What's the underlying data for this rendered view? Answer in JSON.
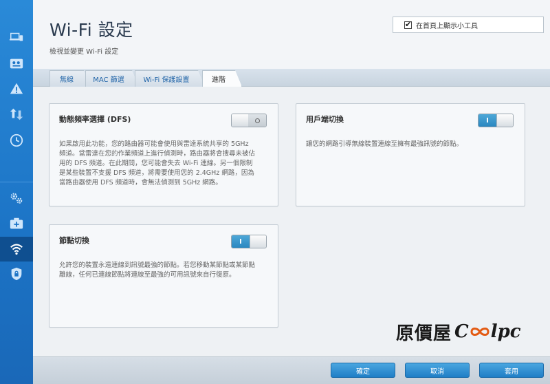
{
  "header": {
    "title": "Wi-Fi 設定",
    "subtitle": "檢視並變更 Wi-Fi 設定",
    "widget_label": "在首頁上顯示小工具"
  },
  "tabs": [
    {
      "label": "無線"
    },
    {
      "label": "MAC 篩選"
    },
    {
      "label": "Wi-Fi 保護設置"
    },
    {
      "label": "進階"
    }
  ],
  "cards": {
    "dfs": {
      "title": "動態頻率選擇 (DFS)",
      "desc_lines": [
        "如果啟用此功能，您的路由器可能會使用與雷達系統共享的 5GHz",
        "頻道。當雷達在您的作業頻道上進行偵測時，路由器將會搜尋未被佔",
        "用的 DFS 頻道。在此期間，您可能會失去 Wi-Fi 連線。另一個限制",
        "是某些裝置不支援 DFS 頻道，將需要使用您的 2.4GHz 網路，因為",
        "當路由器使用 DFS 頻道時，會無法偵測到 5GHz 網路。"
      ],
      "toggle_state": "off"
    },
    "client": {
      "title": "用戶端切換",
      "desc_lines": [
        "讓您的網路引導無線裝置連線至擁有最強訊號的節點。"
      ],
      "toggle_state": "on",
      "toggle_on_label": "I"
    },
    "node": {
      "title": "節點切換",
      "desc_lines": [
        "允許您的裝置永遠連線到訊號最強的節點。若您移動某節點或某節點",
        "離線，任何已連線節點將連線至最強的可用訊號來自行復原。"
      ],
      "toggle_state": "on",
      "toggle_on_label": "I"
    }
  },
  "footer": {
    "ok_label": "確定",
    "cancel_label": "取消",
    "apply_label": "套用"
  },
  "watermark": {
    "cn": "原價屋",
    "en_c": "C",
    "en_rest": "lpc"
  },
  "sidebar": {
    "icons": [
      "devices-icon",
      "parental-icon",
      "warning-icon",
      "update-icon",
      "clock-icon",
      "settings-icon",
      "camera-icon",
      "wifi-icon",
      "security-icon"
    ],
    "active": "wifi-icon"
  },
  "colors": {
    "sidebar": "#1c74c6",
    "button": "#2a87c0",
    "toggle_on": "#2a87c0"
  }
}
